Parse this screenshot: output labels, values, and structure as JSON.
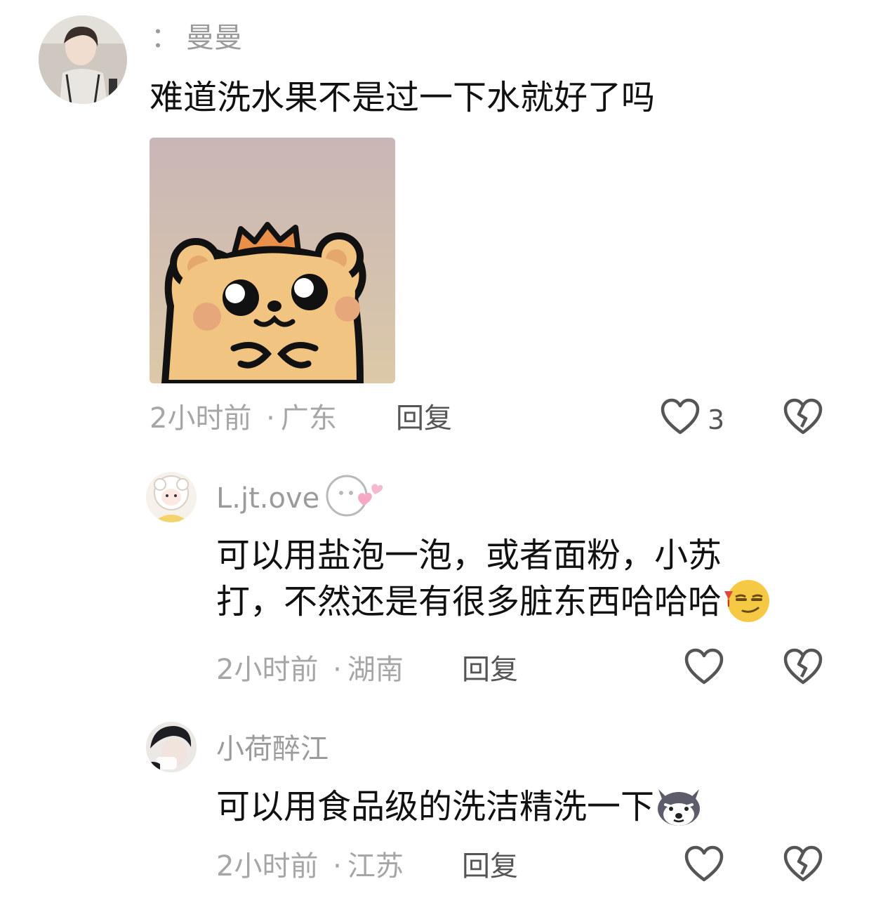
{
  "comments": [
    {
      "username": "曼曼",
      "username_prefix": "：",
      "text": "难道洗水果不是过一下水就好了吗",
      "time": "2小时前",
      "sep": "·",
      "location": "广东",
      "reply_label": "回复",
      "like_count": "3"
    },
    {
      "username": "L.jt.ove",
      "text_line1": "可以用盐泡一泡，或者面粉，小苏",
      "text_line2": "打，不然还是有很多脏东西哈哈哈",
      "time": "2小时前",
      "sep": "·",
      "location": "湖南",
      "reply_label": "回复"
    },
    {
      "username": "小荷醉江",
      "text": "可以用食品级的洗洁精洗一下",
      "time": "2小时前",
      "sep": "·",
      "location": "江苏",
      "reply_label": "回复"
    }
  ],
  "icons": {
    "like": "heart-outline-icon",
    "dislike": "broken-heart-icon",
    "emoji_smirk": "smirk-emoji-icon",
    "emoji_husky": "husky-emoji-icon"
  },
  "colors": {
    "username": "#9b9b9b",
    "meta": "#a6a6a6",
    "icon": "#555555",
    "sticker_bg": "#cdbdb8",
    "bear": "#f2c482"
  }
}
